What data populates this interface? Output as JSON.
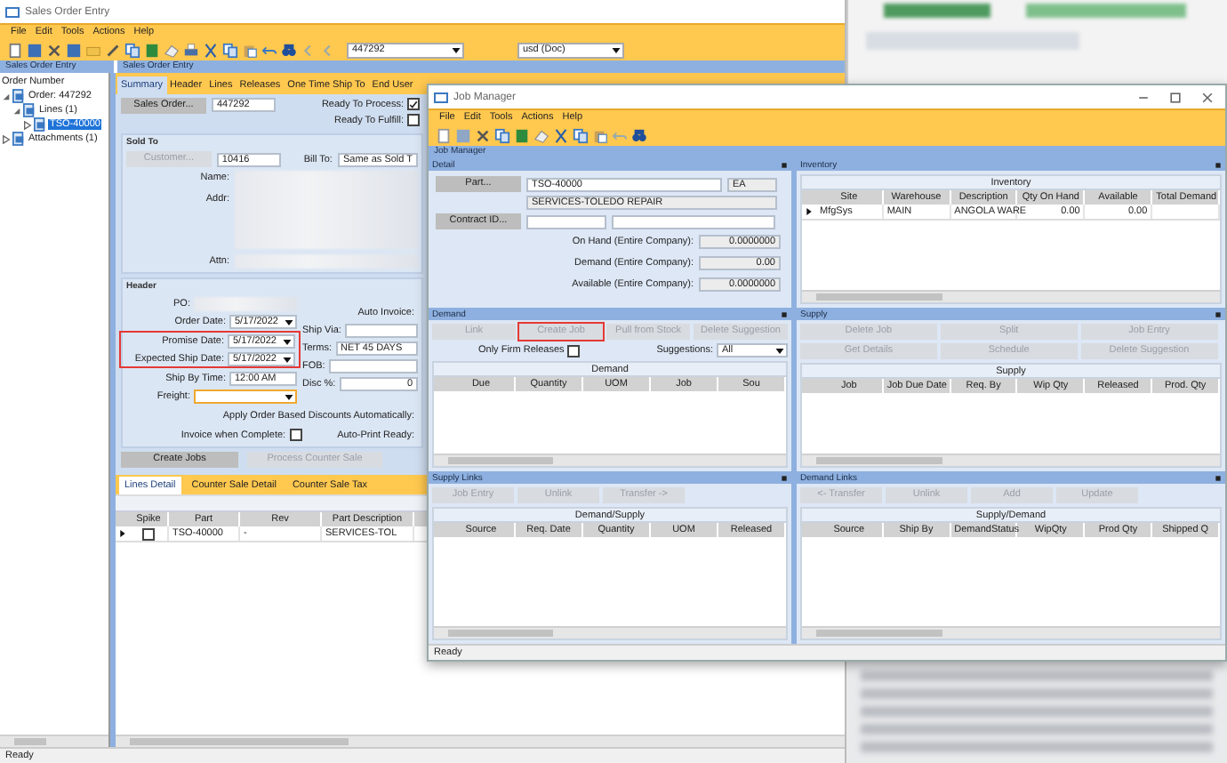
{
  "sales_order": {
    "title": "Sales Order Entry",
    "menu": [
      "File",
      "Edit",
      "Tools",
      "Actions",
      "Help"
    ],
    "toolbar_search": "447292",
    "currency": "usd (Doc)",
    "tree_pane_title": "Sales Order Entry",
    "form_pane_title": "Sales Order Entry",
    "tree_header": "Order Number",
    "tree": [
      {
        "label": "Order: 447292",
        "expanded": true,
        "selected": false,
        "children": [
          {
            "label": "Lines (1)",
            "expanded": true,
            "selected": false,
            "children": [
              {
                "label": "TSO-40000",
                "expanded": false,
                "selected": true
              }
            ]
          }
        ]
      },
      {
        "label": "Attachments (1)",
        "expanded": false,
        "selected": false
      }
    ],
    "tabs": [
      {
        "label": "Summary",
        "selected": true
      },
      {
        "label": "Header",
        "selected": false
      },
      {
        "label": "Lines",
        "selected": false
      },
      {
        "label": "Releases",
        "selected": false
      },
      {
        "label": "One Time Ship To",
        "selected": false
      },
      {
        "label": "End User",
        "selected": false
      }
    ],
    "sales_order_button": "Sales Order...",
    "order_number": "447292",
    "flags": [
      {
        "label": "Ready To Process:",
        "checked": true
      },
      {
        "label": "Ready To Fulfill:",
        "checked": false
      }
    ],
    "sold_to": {
      "title": "Sold To",
      "customer_button": "Customer...",
      "customer_id": "10416",
      "bill_to_label": "Bill To:",
      "bill_to": "Same as Sold T",
      "name_label": "Name:",
      "addr_label": "Addr:",
      "attn_label": "Attn:"
    },
    "header": {
      "title": "Header",
      "po_label": "PO:",
      "dates": [
        {
          "label": "Order Date:",
          "value": "5/17/2022",
          "highlighted": false
        },
        {
          "label": "Promise Date:",
          "value": "5/17/2022",
          "highlighted": true
        },
        {
          "label": "Expected Ship Date:",
          "value": "5/17/2022",
          "highlighted": true
        }
      ],
      "ship_by_time_label": "Ship By Time:",
      "ship_by_time": "12:00 AM",
      "freight_label": "Freight:",
      "auto_invoice_label": "Auto Invoice:",
      "ship_via_label": "Ship Via:",
      "terms_label": "Terms:",
      "terms": "NET 45 DAYS",
      "fob_label": "FOB:",
      "disc_label": "Disc %:",
      "disc": "0",
      "apply_discounts_label": "Apply Order Based Discounts Automatically:",
      "invoice_when_complete": {
        "label": "Invoice when Complete:",
        "checked": false
      },
      "auto_print_label": "Auto-Print Ready:"
    },
    "actions": [
      {
        "label": "Create Jobs",
        "disabled": false
      },
      {
        "label": "Process Counter Sale",
        "disabled": true
      }
    ],
    "sub_tabs": [
      {
        "label": "Lines Detail",
        "selected": true
      },
      {
        "label": "Counter Sale Detail",
        "selected": false
      },
      {
        "label": "Counter Sale Tax",
        "selected": false
      }
    ],
    "lines_grid": {
      "columns": [
        "Spike",
        "Part",
        "Rev",
        "Part Description"
      ],
      "rows": [
        {
          "cells": [
            {
              "kind": "checkbox",
              "checked": false
            },
            "TSO-40000",
            "-",
            "SERVICES-TOL"
          ]
        }
      ]
    },
    "status": "Ready"
  },
  "job_manager": {
    "title": "Job Manager",
    "menu": [
      "File",
      "Edit",
      "Tools",
      "Actions",
      "Help"
    ],
    "pane_title": "Job Manager",
    "detail": {
      "title": "Detail",
      "part_button": "Part...",
      "part": "TSO-40000",
      "uom": "EA",
      "description": "SERVICES-TOLEDO REPAIR",
      "contract_button": "Contract ID...",
      "quantities": [
        {
          "label": "On Hand (Entire Company):",
          "value": "0.0000000"
        },
        {
          "label": "Demand (Entire Company):",
          "value": "0.00"
        },
        {
          "label": "Available (Entire Company):",
          "value": "0.0000000"
        }
      ]
    },
    "inventory": {
      "title": "Inventory",
      "grid": {
        "title": "Inventory",
        "columns": [
          "Site",
          "Warehouse",
          "Description",
          "Qty On Hand",
          "Available",
          "Total Demand"
        ],
        "rows": [
          {
            "cells": [
              "MfgSys",
              "MAIN",
              "ANGOLA WARE",
              "0.00",
              "0.00"
            ]
          }
        ]
      }
    },
    "demand": {
      "title": "Demand",
      "buttons": [
        {
          "label": "Link",
          "disabled": true,
          "highlighted": false
        },
        {
          "label": "Create Job",
          "disabled": true,
          "highlighted": true
        },
        {
          "label": "Pull from Stock",
          "disabled": true,
          "highlighted": false
        },
        {
          "label": "Delete Suggestion",
          "disabled": true,
          "highlighted": false
        }
      ],
      "only_firm": {
        "label": "Only Firm Releases",
        "checked": false
      },
      "suggestions_label": "Suggestions:",
      "suggestions": "All",
      "grid": {
        "title": "Demand",
        "columns": [
          "Due",
          "Quantity",
          "UOM",
          "Job",
          "Sou"
        ]
      }
    },
    "supply": {
      "title": "Supply",
      "buttons": [
        {
          "label": "Delete Job",
          "disabled": true,
          "highlighted": false
        },
        {
          "label": "Split",
          "disabled": true,
          "highlighted": false
        },
        {
          "label": "Job Entry",
          "disabled": true,
          "highlighted": false
        },
        {
          "label": "Get Details",
          "disabled": true,
          "highlighted": false
        },
        {
          "label": "Schedule",
          "disabled": true,
          "highlighted": false
        },
        {
          "label": "Delete Suggestion",
          "disabled": true,
          "highlighted": false
        }
      ],
      "grid": {
        "title": "Supply",
        "columns": [
          "Job",
          "Job Due Date",
          "Req. By",
          "Wip Qty",
          "Released",
          "Prod. Qty"
        ]
      }
    },
    "supply_links": {
      "title": "Supply Links",
      "buttons": [
        {
          "label": "Job Entry",
          "disabled": true,
          "highlighted": false
        },
        {
          "label": "Unlink",
          "disabled": true,
          "highlighted": false
        },
        {
          "label": "Transfer ->",
          "disabled": true,
          "highlighted": false
        }
      ],
      "grid": {
        "title": "Demand/Supply",
        "columns": [
          "Source",
          "Req. Date",
          "Quantity",
          "UOM",
          "Released"
        ]
      }
    },
    "demand_links": {
      "title": "Demand Links",
      "buttons": [
        {
          "label": "<- Transfer",
          "disabled": true,
          "highlighted": false
        },
        {
          "label": "Unlink",
          "disabled": true,
          "highlighted": false
        },
        {
          "label": "Add",
          "disabled": true,
          "highlighted": false
        },
        {
          "label": "Update",
          "disabled": true,
          "highlighted": false
        }
      ],
      "grid": {
        "title": "Supply/Demand",
        "columns": [
          "Source",
          "Ship By",
          "DemandStatus",
          "WipQty",
          "Prod Qty",
          "Shipped Q"
        ]
      }
    },
    "status": "Ready"
  }
}
